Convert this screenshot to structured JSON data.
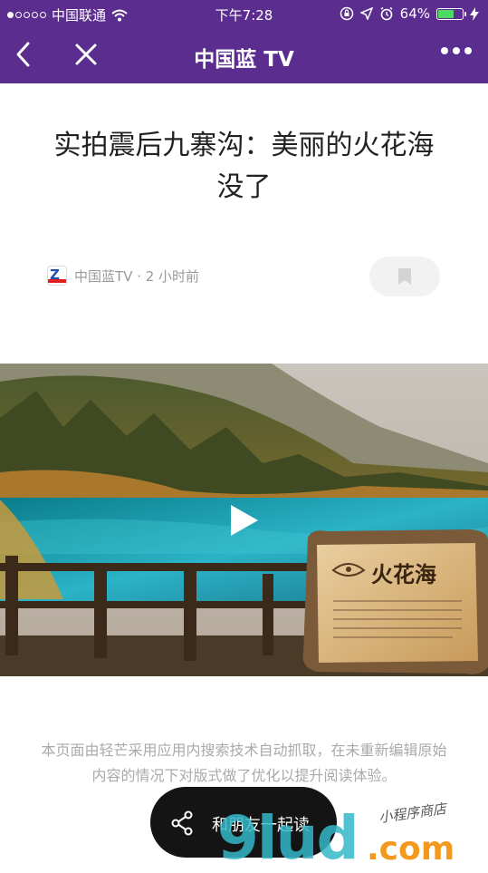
{
  "status_bar": {
    "carrier": "中国联通",
    "time": "下午7:28",
    "battery": "64%",
    "battery_level": 0.64
  },
  "nav": {
    "title": "中国蓝 TV",
    "icons": [
      "back-arrow-icon",
      "close-icon",
      "more-icon"
    ]
  },
  "article": {
    "title": "实拍震后九寨沟：美丽的火花海没了",
    "source": "中国蓝TV · 2 小时前"
  },
  "video": {
    "sign_text": "火花海"
  },
  "notice": "本页面由轻芒采用应用内搜索技术自动抓取，在未重新编辑原始内容的情况下对版式做了优化以提升阅读体验。",
  "share_button": {
    "label": "和朋友一起读"
  },
  "watermark": {
    "main": "9lud",
    "domain": ".com",
    "tagline": "小程序商店"
  },
  "colors": {
    "nav_bg": "#5b2d8e",
    "pill_bg": "#141414"
  }
}
